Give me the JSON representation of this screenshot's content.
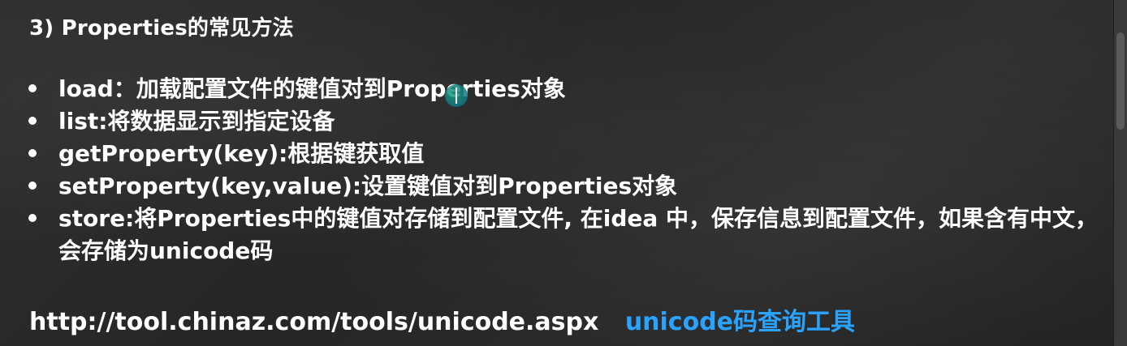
{
  "heading": "3) Properties的常见方法",
  "bullets": [
    "load：加载配置文件的键值对到Properties对象",
    "list:将数据显示到指定设备",
    "getProperty(key):根据键获取值",
    "setProperty(key,value):设置键值对到Properties对象",
    "store:将Properties中的键值对存储到配置文件, 在idea 中，保存信息到配置文件，如果含有中文，会存储为unicode码"
  ],
  "footer": {
    "url": "http://tool.chinaz.com/tools/unicode.aspx",
    "tool_label": "unicode码查询工具",
    "tool_color": "#2aa3ff"
  }
}
